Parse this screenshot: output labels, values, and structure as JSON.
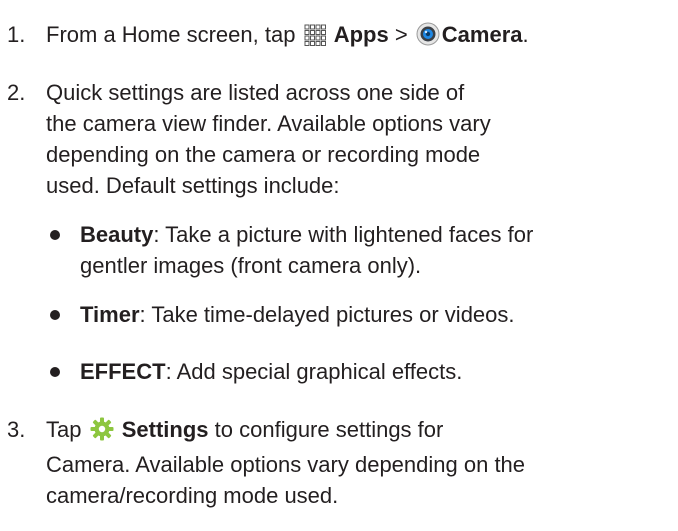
{
  "steps": [
    {
      "number": "1.",
      "pre": "From a Home screen, tap",
      "apps_icon": "apps-grid-icon",
      "apps_label": "Apps",
      "separator": ">",
      "camera_icon": "camera-app-icon",
      "camera_label": "Camera",
      "end": "."
    },
    {
      "number": "2.",
      "lines": [
        "Quick settings are listed across one side of",
        "the camera view finder. Available options vary",
        "depending on the camera or recording mode",
        "used. Default settings include:"
      ],
      "bullets": [
        {
          "term": "Beauty",
          "lines": [
            ": Take a picture with lightened faces for",
            "gentler images (front camera only)."
          ]
        },
        {
          "term": "Timer",
          "lines": [
            ": Take time-delayed pictures or videos."
          ]
        },
        {
          "term": "EFFECT",
          "lines": [
            ": Add special graphical effects."
          ]
        }
      ]
    },
    {
      "number": "3.",
      "pre": "Tap",
      "settings_icon": "settings-gear-icon",
      "settings_label": "Settings",
      "line1_rest": "to configure settings for",
      "lines": [
        "Camera. Available options vary depending on the",
        "camera/recording mode used."
      ]
    }
  ],
  "colors": {
    "text": "#231f20",
    "gear": "#8dc63f",
    "camera_blue": "#1e88e5"
  }
}
